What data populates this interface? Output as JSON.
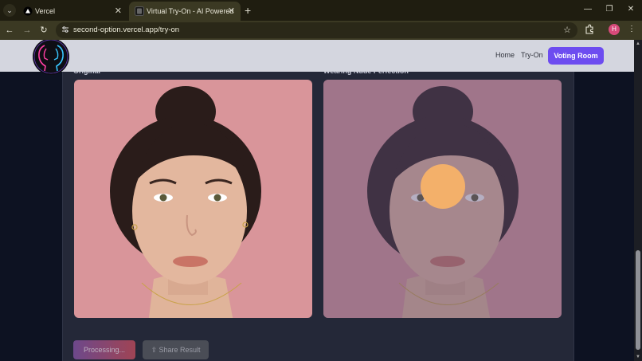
{
  "browser": {
    "tabs": [
      {
        "title": "Vercel",
        "active": false,
        "icon": "vercel-triangle-icon"
      },
      {
        "title": "Virtual Try-On - AI Powered",
        "active": true,
        "icon": "app-favicon"
      }
    ],
    "tab_close_glyph": "✕",
    "new_tab_glyph": "+",
    "window_controls": {
      "minimize": "—",
      "restore": "❐",
      "close": "✕"
    },
    "nav": {
      "back": "←",
      "forward": "→",
      "reload": "↻"
    },
    "url": "second-option.vercel.app/try-on",
    "bookmark_glyph": "☆",
    "profile_initial": "H",
    "menu_glyph": "⋮"
  },
  "site": {
    "nav_links": [
      "Home",
      "Try-On"
    ],
    "cta_label": "Voting Room"
  },
  "content": {
    "original_label": "Original",
    "result_label": "Wearing Nude Perfection",
    "processing_label": "Processing...",
    "share_label": "Share Result"
  },
  "colors": {
    "accent": "#6d4cf0",
    "page_background": "#0d1222",
    "card_background": "#242838",
    "photo_background": "#d9959a",
    "loading_spinner": "#f3b06a"
  }
}
